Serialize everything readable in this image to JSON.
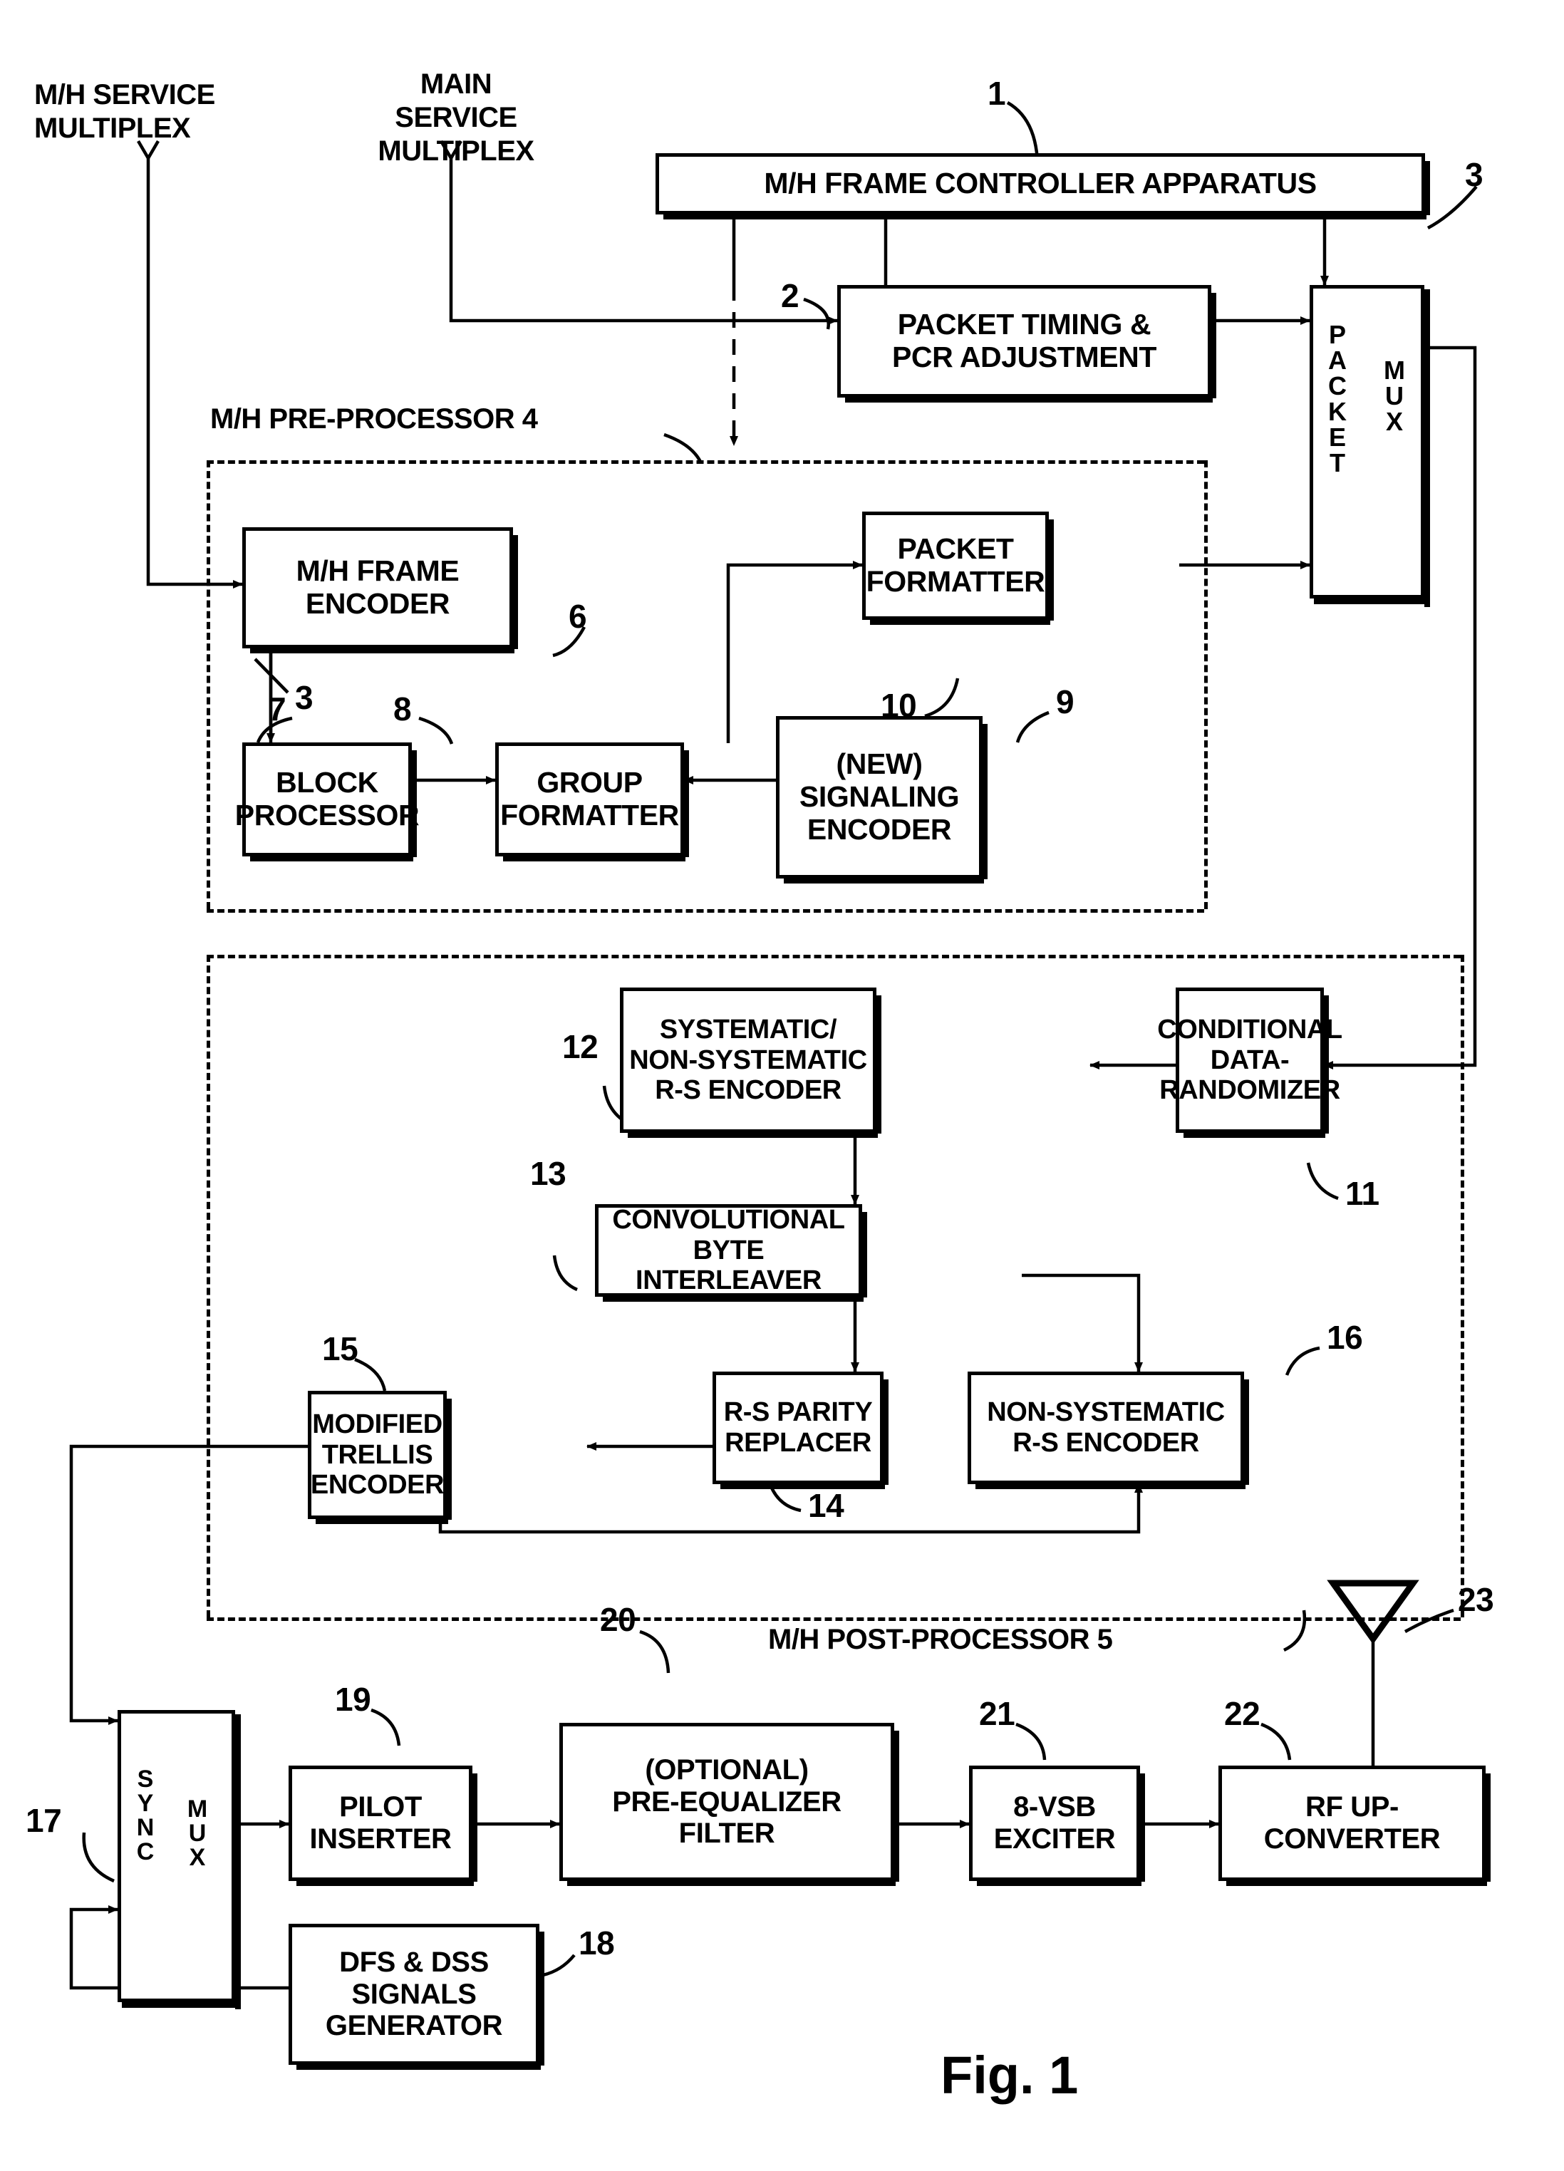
{
  "figure": {
    "caption": "Fig. 1",
    "title": "ATSC M/H transmitter block diagram"
  },
  "inputs": [
    {
      "name": "mh-service-multiplex",
      "text": "M/H SERVICE\nMULTIPLEX"
    },
    {
      "name": "main-service-multiplex",
      "text": "MAIN\nSERVICE\nMULTIPLEX"
    }
  ],
  "group_labels": [
    {
      "name": "pre-processor-label",
      "text": "M/H PRE-PROCESSOR 4"
    },
    {
      "name": "post-processor-label",
      "text": "M/H POST-PROCESSOR 5"
    }
  ],
  "blocks": {
    "frame_controller": "M/H FRAME CONTROLLER APPARATUS",
    "packet_timing": "PACKET TIMING &\nPCR ADJUSTMENT",
    "packet_mux_left": "PACKET",
    "packet_mux_right": "MUX",
    "mh_frame_encoder": "M/H FRAME\nENCODER",
    "block_processor": "BLOCK\nPROCESSOR",
    "group_formatter": "GROUP\nFORMATTER",
    "signaling_encoder": "(NEW)\nSIGNALING\nENCODER",
    "packet_formatter": "PACKET\nFORMATTER",
    "conditional_data_randomizer": "CONDITIONAL\nDATA-\nRANDOMIZER",
    "rs_encoder": "SYSTEMATIC/\nNON-SYSTEMATIC\nR-S ENCODER",
    "byte_interleaver": "CONVOLUTIONAL\nBYTE INTERLEAVER",
    "non_systematic_rs_encoder": "NON-SYSTEMATIC\nR-S ENCODER",
    "rs_parity_replacer": "R-S PARITY\nREPLACER",
    "modified_trellis_encoder": "MODIFIED\nTRELLIS\nENCODER",
    "sync_mux_left": "SYNC",
    "sync_mux_right": "MUX",
    "dfs_dss_generator": "DFS & DSS\nSIGNALS\nGENERATOR",
    "pilot_inserter": "PILOT\nINSERTER",
    "pre_equalizer_filter": "(OPTIONAL)\nPRE-EQUALIZER\nFILTER",
    "vsb_exciter": "8-VSB\nEXCITER",
    "rf_up_converter": "RF UP-\nCONVERTER"
  },
  "reference_numerals": {
    "frame_controller": "1",
    "packet_timing": "2",
    "packet_mux": "3",
    "frame_encoder_bus": "3",
    "pre_processor": "4",
    "post_processor": "5",
    "mh_frame_encoder": "6",
    "block_processor": "7",
    "group_formatter": "8",
    "signaling_encoder": "9",
    "packet_formatter": "10",
    "conditional_data_randomizer": "11",
    "rs_encoder": "12",
    "byte_interleaver": "13",
    "rs_parity_replacer": "14",
    "modified_trellis_encoder": "15",
    "non_systematic_rs_encoder": "16",
    "sync_mux": "17",
    "dfs_dss_generator": "18",
    "pilot_inserter": "19",
    "pre_equalizer_filter": "20",
    "vsb_exciter": "21",
    "rf_up_converter": "22",
    "antenna": "23"
  },
  "colors": {
    "ink": "#000000",
    "paper": "#ffffff"
  }
}
